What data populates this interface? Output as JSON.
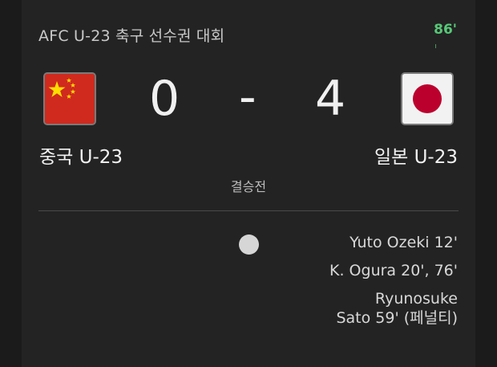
{
  "match": {
    "competition": "AFC U-23 축구 선수권 대회",
    "minute": "86'",
    "round": "결승전"
  },
  "home": {
    "name": "중국 U-23",
    "score": "0",
    "flag_icon": "china-flag-icon"
  },
  "away": {
    "name": "일본 U-23",
    "score": "4",
    "flag_icon": "japan-flag-icon"
  },
  "separator": "-",
  "goals": {
    "away": [
      {
        "lines": [
          "Yuto Ozeki 12'"
        ]
      },
      {
        "lines": [
          "K. Ogura 20', 76'"
        ]
      },
      {
        "lines": [
          "Ryunosuke",
          "Sato 59' (페널티)"
        ]
      }
    ]
  },
  "colors": {
    "background": "#1b1b1b",
    "card": "#232323",
    "live_minute": "#58c878",
    "china_red": "#d02a1f",
    "china_star": "#ffde00",
    "japan_red": "#bc002d"
  }
}
